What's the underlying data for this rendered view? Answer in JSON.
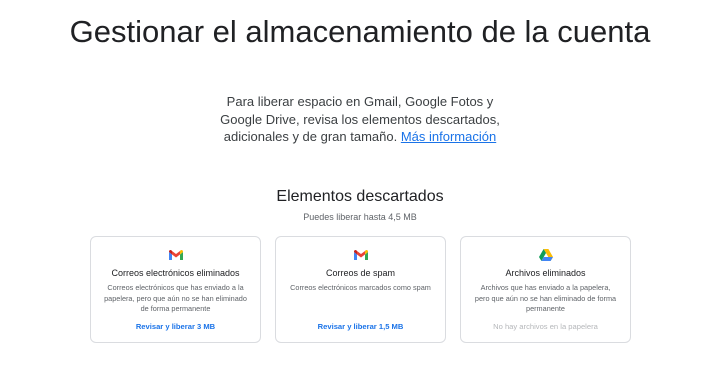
{
  "header": {
    "title": "Gestionar el almacenamiento de la cuenta",
    "intro_text": "Para liberar espacio en Gmail, Google Fotos y Google Drive, revisa los elementos descartados, adicionales y de gran tamaño. ",
    "learn_more_link": "Más información"
  },
  "section": {
    "title": "Elementos descartados",
    "subtitle": "Puedes liberar hasta 4,5 MB"
  },
  "cards": [
    {
      "icon": "gmail-icon",
      "title": "Correos electrónicos eliminados",
      "description": "Correos electrónicos que has enviado a la papelera, pero que aún no se han eliminado de forma permanente",
      "action": "Revisar y liberar 3 MB"
    },
    {
      "icon": "gmail-icon",
      "title": "Correos de spam",
      "description": "Correos electrónicos marcados como spam",
      "action": "Revisar y liberar 1,5 MB"
    },
    {
      "icon": "google-drive-icon",
      "title": "Archivos eliminados",
      "description": "Archivos que has enviado a la papelera, pero que aún no se han eliminado de forma permanente",
      "action": "No hay archivos en la papelera"
    }
  ],
  "colors": {
    "link": "#1a73e8",
    "disabled_text": "#b5b7ba",
    "card_border": "#dadce0"
  }
}
